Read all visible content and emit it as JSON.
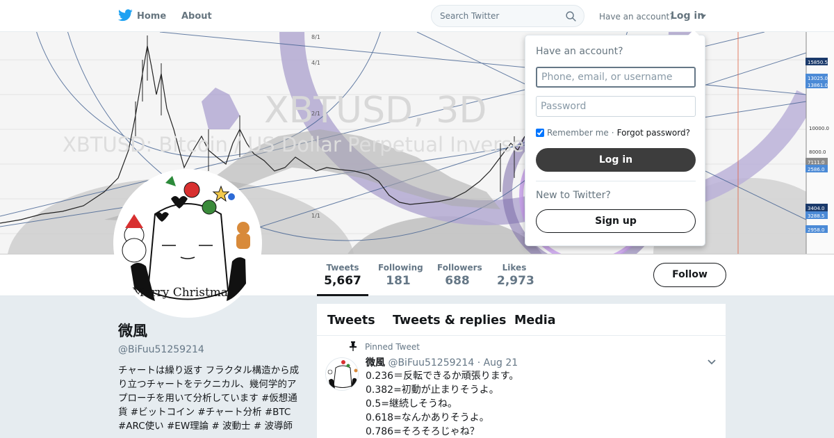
{
  "nav": {
    "home": "Home",
    "about": "About",
    "search_placeholder": "Search Twitter",
    "have_account": "Have an account?",
    "login": "Log in"
  },
  "banner": {
    "watermark_large": "XBTUSD, 3D",
    "watermark_small": "XBTUSD: Bitcoin / US Dollar Perpetual Inverse Swap Contract",
    "fib_labels": [
      "8/1",
      "4/1",
      "2/1",
      "1/1"
    ],
    "price_labels": [
      "15850.5",
      "13025.0",
      "13861.0",
      "10000.0",
      "8000.0",
      "7111.0",
      "2586.0",
      "3404.0",
      "3288.5",
      "2958.0"
    ]
  },
  "stats": [
    {
      "label": "Tweets",
      "value": "5,667"
    },
    {
      "label": "Following",
      "value": "181"
    },
    {
      "label": "Followers",
      "value": "688"
    },
    {
      "label": "Likes",
      "value": "2,973"
    }
  ],
  "follow_label": "Follow",
  "avatar": {
    "caption": "Merry Christmas"
  },
  "profile": {
    "name": "微風",
    "handle": "@BiFuu51259214",
    "bio": "チャートは繰り返す フラクタル構造から成り立つチャートをテクニカル、幾何学的アプローチを用いて分析しています #仮想通貨 #ビットコイン #チャート分析 #BTC #ARC使い #EW理論 # 波動士 # 波導師"
  },
  "timeline": {
    "tabs": [
      "Tweets",
      "Tweets & replies",
      "Media"
    ],
    "pinned_label": "Pinned Tweet",
    "tweet": {
      "name": "微風",
      "handle": "@BiFuu51259214",
      "separator": "·",
      "date": "Aug 21",
      "lines": [
        "0.236＝反転できるか頑張ります。",
        "0.382=初動が止まりそうよ。",
        "0.5=継続しそうね。",
        "0.618=なんかありそうよ。",
        "0.786=そろそろじゃね？"
      ]
    }
  },
  "login_dropdown": {
    "title": "Have an account?",
    "username_placeholder": "Phone, email, or username",
    "password_placeholder": "Password",
    "remember_me": "Remember me",
    "separator": "·",
    "forgot_password": "Forgot password?",
    "login_button": "Log in",
    "new_to_twitter": "New to Twitter?",
    "signup_button": "Sign up"
  },
  "colors": {
    "brand_blue": "#1da1f2",
    "dark_button": "#3d3d3d",
    "page_bg": "#e6ecf0"
  }
}
